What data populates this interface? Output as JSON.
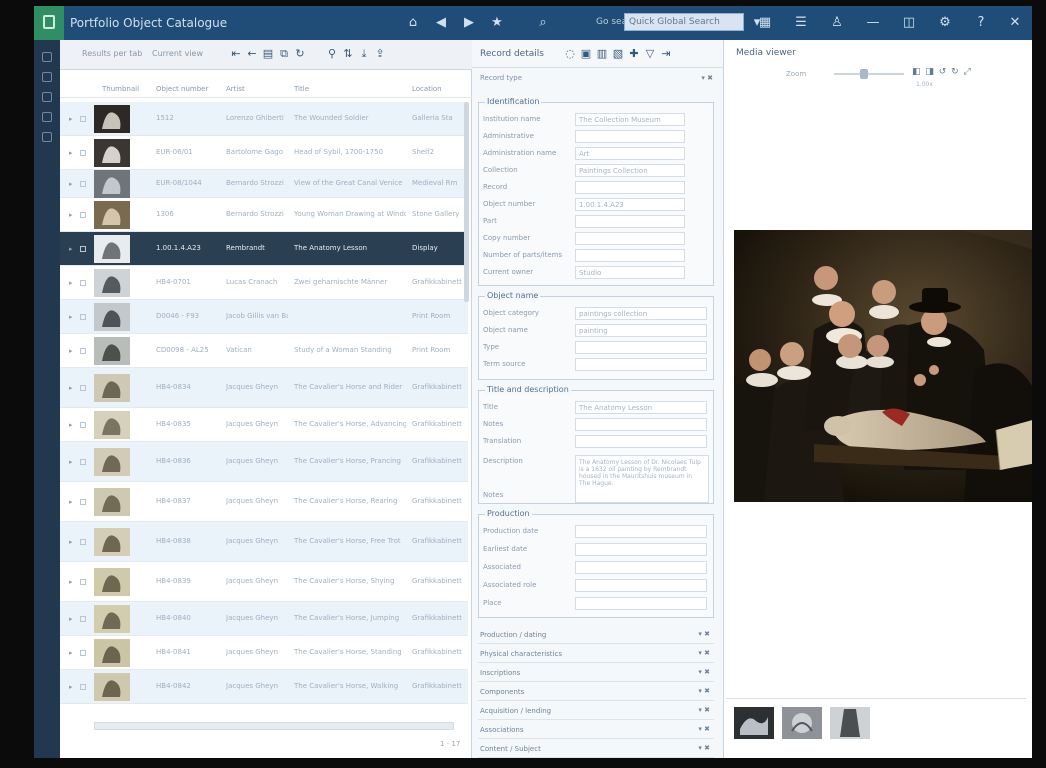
{
  "app": {
    "title": "Portfolio Object Catalogue",
    "search_label": "Go search",
    "search_placeholder": "Quick Global Search"
  },
  "left_panel": {
    "filter_label": "Results per tab",
    "filter_value": "Current view",
    "columns": [
      "Thumbnail",
      "Object number",
      "Artist",
      "Title",
      "Location"
    ],
    "rows": [
      {
        "num": "1512",
        "artist": "Lorenzo Ghiberti",
        "title": "The Wounded Soldier",
        "loc": "Galleria Sta"
      },
      {
        "num": "EUR-06/01",
        "artist": "Bartolome Gago",
        "title": "Head of Sybil, 1700-1750",
        "loc": "Shelf2"
      },
      {
        "num": "EUR-08/1044",
        "artist": "Bernardo Strozzi",
        "title": "View of the Great Canal Venice",
        "loc": "Medieval Rm"
      },
      {
        "num": "1306",
        "artist": "Bernardo Strozzi",
        "title": "Young Woman Drawing at Window",
        "loc": "Stone Gallery"
      },
      {
        "num": "1.00.1.4.A23",
        "artist": "Rembrandt",
        "title": "The Anatomy Lesson",
        "loc": "Display"
      },
      {
        "num": "HB4-0701",
        "artist": "Lucas Cranach",
        "title": "Zwei geharnischte Männer",
        "loc": "Grafikkabinett"
      },
      {
        "num": "D0046 - F93",
        "artist": "Jacob Gillis van Baer",
        "title": "",
        "loc": "Print Room"
      },
      {
        "num": "CD0098 - AL25",
        "artist": "Vatican",
        "title": "Study of a Woman Standing",
        "loc": "Print Room"
      },
      {
        "num": "HB4-0834",
        "artist": "Jacques Gheyn",
        "title": "The Cavalier's Horse and Rider",
        "loc": "Grafikkabinett"
      },
      {
        "num": "HB4-0835",
        "artist": "Jacques Gheyn",
        "title": "The Cavalier's Horse, Advancing",
        "loc": "Grafikkabinett"
      },
      {
        "num": "HB4-0836",
        "artist": "Jacques Gheyn",
        "title": "The Cavalier's Horse, Prancing",
        "loc": "Grafikkabinett"
      },
      {
        "num": "HB4-0837",
        "artist": "Jacques Gheyn",
        "title": "The Cavalier's Horse, Rearing",
        "loc": "Grafikkabinett"
      },
      {
        "num": "HB4-0838",
        "artist": "Jacques Gheyn",
        "title": "The Cavalier's Horse, Free Trot",
        "loc": "Grafikkabinett"
      },
      {
        "num": "HB4-0839",
        "artist": "Jacques Gheyn",
        "title": "The Cavalier's Horse, Shying",
        "loc": "Grafikkabinett"
      },
      {
        "num": "HB4-0840",
        "artist": "Jacques Gheyn",
        "title": "The Cavalier's Horse, Jumping",
        "loc": "Grafikkabinett"
      },
      {
        "num": "HB4-0841",
        "artist": "Jacques Gheyn",
        "title": "The Cavalier's Horse, Standing",
        "loc": "Grafikkabinett"
      },
      {
        "num": "HB4-0842",
        "artist": "Jacques Gheyn",
        "title": "The Cavalier's Horse, Walking",
        "loc": "Grafikkabinett"
      }
    ],
    "footer": "1 - 17"
  },
  "center": {
    "title": "Record details",
    "record_type_label": "Record type",
    "identification": {
      "legend": "Identification",
      "fields": [
        {
          "label": "Institution name",
          "value": "The Collection Museum"
        },
        {
          "label": "Administrative",
          "value": ""
        },
        {
          "label": "Administration name",
          "value": "Art"
        },
        {
          "label": "Collection",
          "value": "Paintings Collection"
        },
        {
          "label": "Record",
          "value": ""
        },
        {
          "label": "Object number",
          "value": "1.00.1.4.A23"
        },
        {
          "label": "Part",
          "value": ""
        },
        {
          "label": "Copy number",
          "value": ""
        },
        {
          "label": "Number of parts/items",
          "value": ""
        },
        {
          "label": "Current owner",
          "value": "Studio"
        }
      ]
    },
    "object_name": {
      "legend": "Object name",
      "fields": [
        {
          "label": "Object category",
          "value": "paintings collection"
        },
        {
          "label": "Object name",
          "value": "painting"
        },
        {
          "label": "Type",
          "value": ""
        },
        {
          "label": "Term source",
          "value": ""
        }
      ]
    },
    "title_desc": {
      "legend": "Title and description",
      "fields": [
        {
          "label": "Title",
          "value": "The Anatomy Lesson"
        },
        {
          "label": "Notes",
          "value": ""
        },
        {
          "label": "Translation",
          "value": ""
        },
        {
          "label": "Description",
          "value": ""
        }
      ],
      "description": "The Anatomy Lesson of Dr. Nicolaes Tulp is a 1632 oil painting by Rembrandt housed in the Mauritshuis museum in The Hague.",
      "notes_label": "Notes"
    },
    "production": {
      "legend": "Production",
      "fields": [
        {
          "label": "Production date",
          "value": ""
        },
        {
          "label": "Earliest date",
          "value": ""
        },
        {
          "label": "Associated",
          "value": ""
        },
        {
          "label": "Associated role",
          "value": ""
        },
        {
          "label": "Place",
          "value": ""
        }
      ]
    },
    "collapsed": [
      "Production / dating",
      "Physical characteristics",
      "Inscriptions",
      "Components",
      "Acquisition / lending",
      "Associations",
      "Content / Subject"
    ]
  },
  "media": {
    "title": "Media viewer",
    "zoom_label": "Zoom",
    "size_label": "1.00x"
  }
}
